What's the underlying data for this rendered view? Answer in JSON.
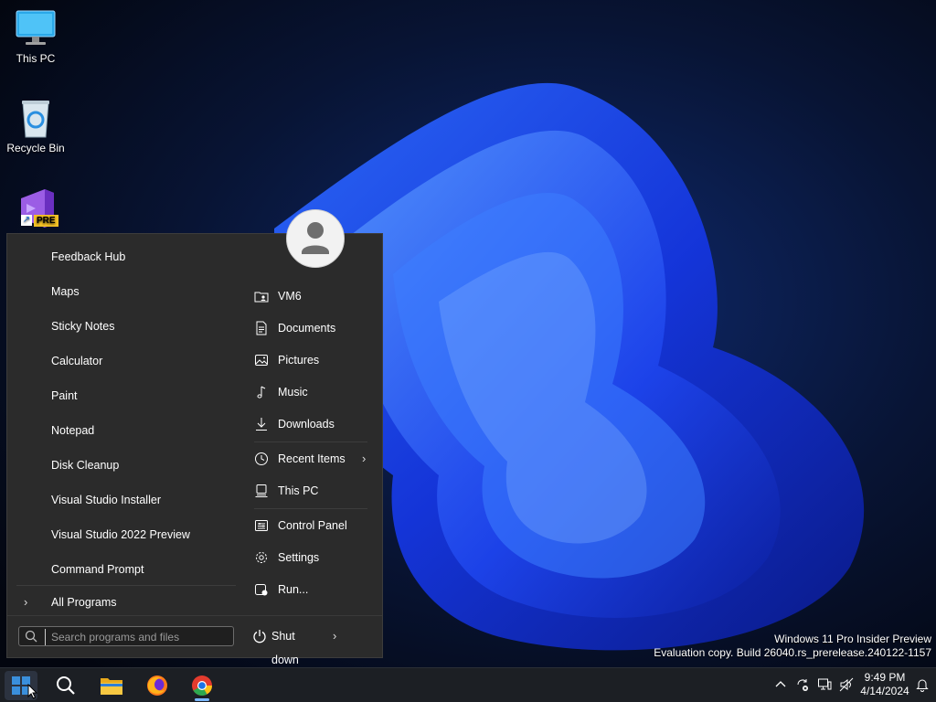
{
  "desktop": {
    "icons": [
      {
        "label": "This PC"
      },
      {
        "label": "Recycle Bin"
      },
      {
        "badge": "PRE"
      }
    ],
    "watermark": {
      "line1": "Windows 11 Pro Insider Preview",
      "line2": "Evaluation copy. Build 26040.rs_prerelease.240122-1157"
    }
  },
  "start_menu": {
    "programs": [
      "Feedback Hub",
      "Maps",
      "Sticky Notes",
      "Calculator",
      "Paint",
      "Notepad",
      "Disk Cleanup",
      "Visual Studio Installer",
      "Visual Studio 2022 Preview",
      "Command Prompt"
    ],
    "all_programs": "All Programs",
    "places": [
      {
        "label": "VM6",
        "icon": "user-folder-icon"
      },
      {
        "label": "Documents",
        "icon": "document-icon"
      },
      {
        "label": "Pictures",
        "icon": "picture-icon"
      },
      {
        "label": "Music",
        "icon": "music-note-icon"
      },
      {
        "label": "Downloads",
        "icon": "download-icon"
      },
      {
        "label": "Recent Items",
        "icon": "clock-icon"
      },
      {
        "label": "This PC",
        "icon": "computer-icon"
      },
      {
        "label": "Control Panel",
        "icon": "control-panel-icon"
      },
      {
        "label": "Settings",
        "icon": "gear-icon"
      },
      {
        "label": "Run...",
        "icon": "run-icon"
      }
    ],
    "search": {
      "placeholder": "Search programs and files"
    },
    "shutdown": "Shut down"
  },
  "taskbar": {
    "time": "9:49 PM",
    "date": "4/14/2024",
    "apps": [
      "start-button",
      "search-button",
      "file-explorer",
      "firefox",
      "chrome"
    ]
  },
  "colors": {
    "menu_bg": "#2b2b2b",
    "taskbar_bg": "#1c1f24",
    "accent": "#3a8fdc",
    "wallpaper_blue": "#1f4bff"
  }
}
